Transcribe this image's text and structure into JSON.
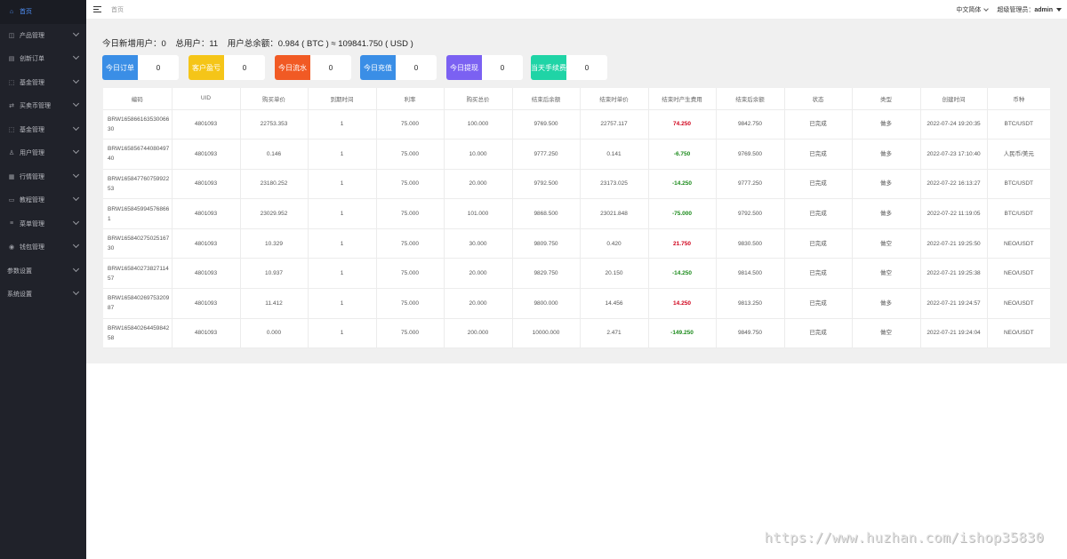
{
  "sidebar": {
    "items": [
      {
        "label": "首页",
        "icon": "home-icon",
        "glyph": "⌂",
        "active": true,
        "chevron": false
      },
      {
        "label": "产品管理",
        "icon": "box-icon",
        "glyph": "◫",
        "active": false,
        "chevron": true
      },
      {
        "label": "创新订单",
        "icon": "order-icon",
        "glyph": "▤",
        "active": false,
        "chevron": true
      },
      {
        "label": "基金管理",
        "icon": "fund-icon",
        "glyph": "⬚",
        "active": false,
        "chevron": true
      },
      {
        "label": "买卖币管理",
        "icon": "exchange-icon",
        "glyph": "⇄",
        "active": false,
        "chevron": true
      },
      {
        "label": "基金管理",
        "icon": "fund-icon",
        "glyph": "⬚",
        "active": false,
        "chevron": true
      },
      {
        "label": "用户管理",
        "icon": "user-icon",
        "glyph": "♙",
        "active": false,
        "chevron": true
      },
      {
        "label": "行情管理",
        "icon": "market-icon",
        "glyph": "▦",
        "active": false,
        "chevron": true
      },
      {
        "label": "教程管理",
        "icon": "book-icon",
        "glyph": "▭",
        "active": false,
        "chevron": true
      },
      {
        "label": "菜单管理",
        "icon": "menu-icon",
        "glyph": "≡",
        "active": false,
        "chevron": true
      },
      {
        "label": "钱包管理",
        "icon": "wallet-icon",
        "glyph": "◉",
        "active": false,
        "chevron": true
      },
      {
        "label": "参数设置",
        "icon": "",
        "glyph": "",
        "active": false,
        "chevron": true
      },
      {
        "label": "系统设置",
        "icon": "",
        "glyph": "",
        "active": false,
        "chevron": true
      }
    ]
  },
  "header": {
    "breadcrumb": "首页",
    "language": "中文简体",
    "admin_prefix": "超级管理员：",
    "admin_name": "admin"
  },
  "summary": {
    "text": "今日新增用户：0    总用户：11    用户总余额：0.984 ( BTC ) ≈ 109841.750 ( USD )"
  },
  "stats": [
    {
      "label": "今日订单",
      "value": "0",
      "color": "#3a8ee6"
    },
    {
      "label": "客户盈亏",
      "value": "0",
      "color": "#f5c518"
    },
    {
      "label": "今日流水",
      "value": "0",
      "color": "#f15a24"
    },
    {
      "label": "今日充值",
      "value": "0",
      "color": "#3a8ee6"
    },
    {
      "label": "今日提现",
      "value": "0",
      "color": "#7b61f2"
    },
    {
      "label": "当天手续费",
      "value": "0",
      "color": "#1fd4a6"
    }
  ],
  "table": {
    "headers": [
      "编码",
      "UID",
      "购买单价",
      "到期时间",
      "利率",
      "购买总价",
      "结束后余额",
      "结束时单价",
      "结束时产生费用",
      "结束后余额",
      "状态",
      "类型",
      "创建时间",
      "币种"
    ],
    "rows": [
      [
        "BRW16586616353006630",
        "4801093",
        "22753.353",
        "1",
        "75.000",
        "100.000",
        "9769.500",
        "22757.117",
        "74.250",
        "9842.750",
        "已完成",
        "做多",
        "2022-07-24 19:20:35",
        "BTC/USDT"
      ],
      [
        "BRW16585674408049740",
        "4801093",
        "0.146",
        "1",
        "75.000",
        "10.000",
        "9777.250",
        "0.141",
        "-6.750",
        "9769.500",
        "已完成",
        "做多",
        "2022-07-23 17:10:40",
        "人民币/美元"
      ],
      [
        "BRW16584776075992253",
        "4801093",
        "23180.252",
        "1",
        "75.000",
        "20.000",
        "9792.500",
        "23173.025",
        "-14.250",
        "9777.250",
        "已完成",
        "做多",
        "2022-07-22 16:13:27",
        "BTC/USDT"
      ],
      [
        "BRW1658459945768661",
        "4801093",
        "23029.952",
        "1",
        "75.000",
        "101.000",
        "9868.500",
        "23021.848",
        "-75.000",
        "9792.500",
        "已完成",
        "做多",
        "2022-07-22 11:19:05",
        "BTC/USDT"
      ],
      [
        "BRW16584027502516730",
        "4801093",
        "10.329",
        "1",
        "75.000",
        "30.000",
        "9809.750",
        "0.420",
        "21.750",
        "9830.500",
        "已完成",
        "做空",
        "2022-07-21 19:25:50",
        "NEO/USDT"
      ],
      [
        "BRW16584027382711457",
        "4801093",
        "10.937",
        "1",
        "75.000",
        "20.000",
        "9829.750",
        "20.150",
        "-14.250",
        "9814.500",
        "已完成",
        "做空",
        "2022-07-21 19:25:38",
        "NEO/USDT"
      ],
      [
        "BRW16584026975320987",
        "4801093",
        "11.412",
        "1",
        "75.000",
        "20.000",
        "9800.000",
        "14.456",
        "14.250",
        "9813.250",
        "已完成",
        "做多",
        "2022-07-21 19:24:57",
        "NEO/USDT"
      ],
      [
        "BRW16584026445984258",
        "4801093",
        "0.000",
        "1",
        "75.000",
        "200.000",
        "10000.000",
        "2.471",
        "-149.250",
        "9849.750",
        "已完成",
        "做空",
        "2022-07-21 19:24:04",
        "NEO/USDT"
      ]
    ]
  },
  "watermark": "https://www.huzhan.com/ishop35830"
}
